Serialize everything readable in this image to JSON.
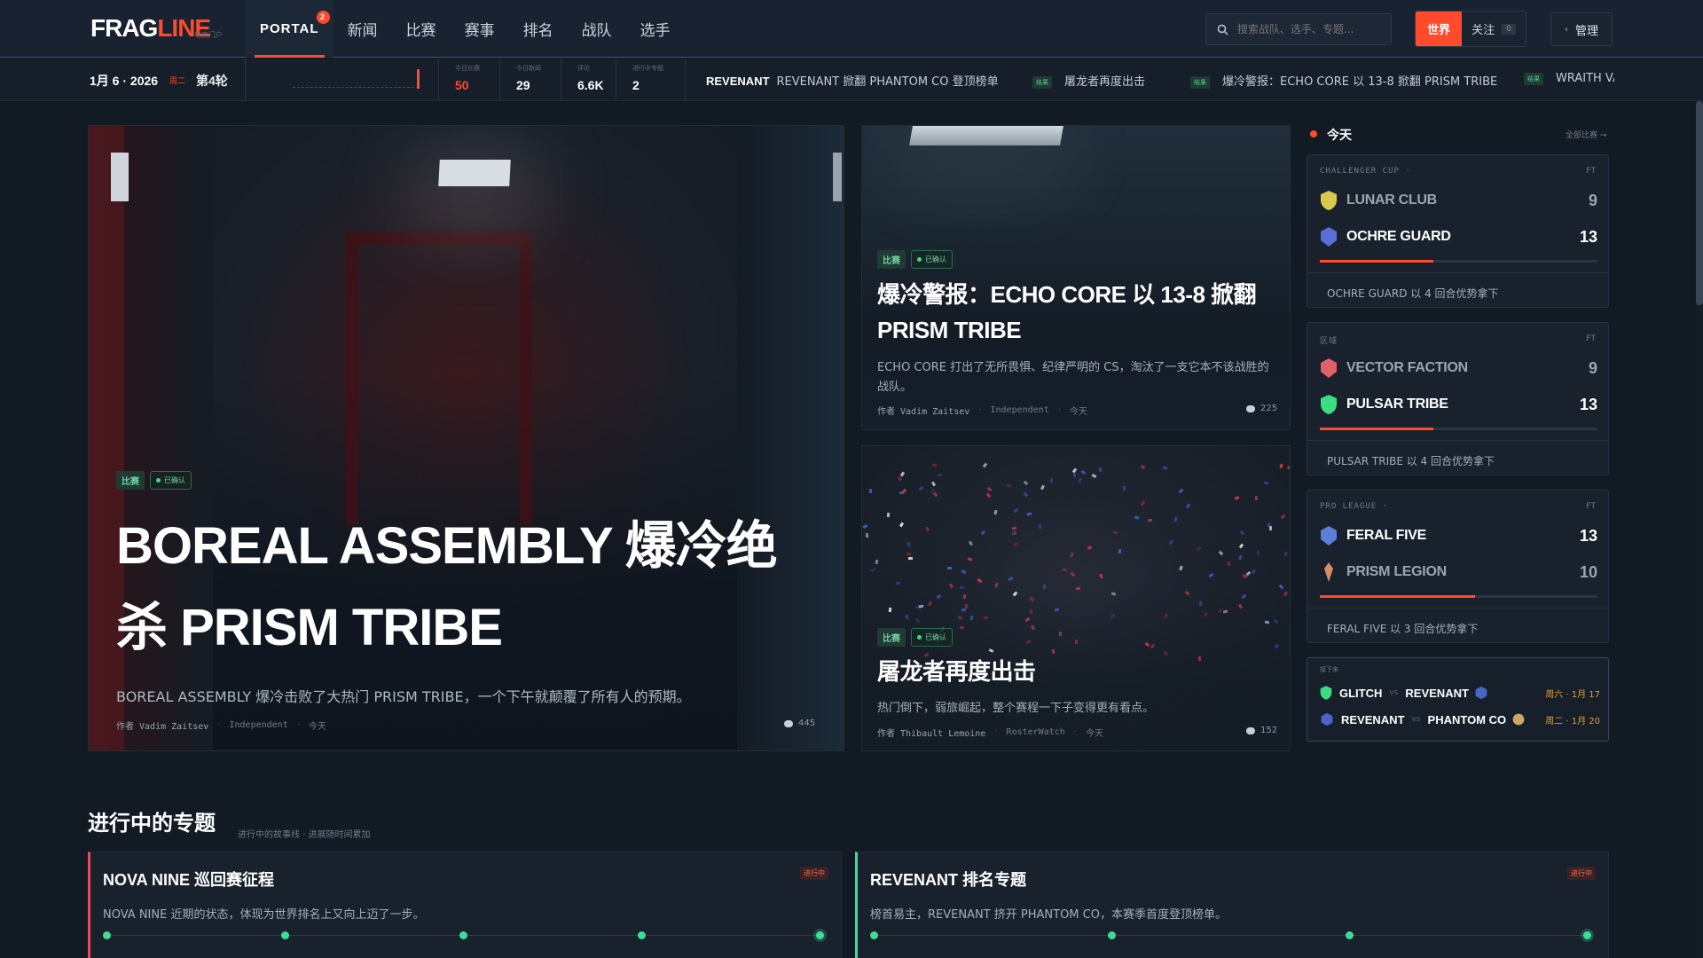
{
  "header": {
    "logo_part1": "FRAG",
    "logo_part2": "LINE",
    "logo_sub": "电竞门户",
    "nav": [
      {
        "label": "PORTAL",
        "badge": "2"
      },
      {
        "label": "新闻"
      },
      {
        "label": "比赛"
      },
      {
        "label": "赛事"
      },
      {
        "label": "排名"
      },
      {
        "label": "战队"
      },
      {
        "label": "选手"
      }
    ],
    "search_placeholder": "搜索战队、选手、专题...",
    "scope_world": "世界",
    "scope_follow": "关注",
    "follow_count": "0",
    "admin_label": "管理",
    "admin_icon": "chevron-left-icon",
    "accent_color": "#ff4a2b"
  },
  "ticker": {
    "date": "1月 6 · 2026",
    "weekday": "周二",
    "round": "第4轮",
    "stats": [
      {
        "label": "今日比赛",
        "value": "50"
      },
      {
        "label": "今日新闻",
        "value": "29"
      },
      {
        "label": "评论",
        "value": "6.6K"
      },
      {
        "label": "进行中专题",
        "value": "2"
      }
    ],
    "news": [
      {
        "tag": "",
        "team": "REVENANT",
        "text": "REVENANT 掀翻 PHANTOM CO 登顶榜单"
      },
      {
        "tag": "结果",
        "team": "",
        "text": "屠龙者再度出击"
      },
      {
        "tag": "结果",
        "team": "",
        "text": "爆冷警报：ECHO CORE 以 13-8 掀翻 PRISM TRIBE"
      },
      {
        "tag": "结果",
        "team": "",
        "text": "WRAITH VA"
      }
    ]
  },
  "hero": {
    "tag": "比赛",
    "confirmed": "已确认",
    "title": "BOREAL ASSEMBLY 爆冷绝杀 PRISM TRIBE",
    "description": "BOREAL ASSEMBLY 爆冷击败了大热门 PRISM TRIBE，一个下午就颠覆了所有人的预期。",
    "author": "作者 Vadim Zaitsev",
    "source": "Independent",
    "time": "今天",
    "comments": "445"
  },
  "mid_cards": [
    {
      "tag": "比赛",
      "confirmed": "已确认",
      "title": "爆冷警报：ECHO CORE 以 13-8 掀翻 PRISM TRIBE",
      "description": "ECHO CORE 打出了无所畏惧、纪律严明的 CS，淘汰了一支它本不该战胜的战队。",
      "author": "作者 Vadim Zaitsev",
      "source": "Independent",
      "time": "今天",
      "comments": "225"
    },
    {
      "tag": "比赛",
      "confirmed": "已确认",
      "title": "屠龙者再度出击",
      "description": "热门倒下，弱旅崛起，整个赛程一下子变得更有看点。",
      "author": "作者 Thibault Lemoine",
      "source": "RosterWatch",
      "time": "今天",
      "comments": "152"
    }
  ],
  "sidebar": {
    "today": "今天",
    "all_matches": "全部比赛 →",
    "matches": [
      {
        "league": "CHALLENGER CUP ·",
        "status": "FT",
        "team1": "LUNAR CLUB",
        "score1": "9",
        "logo1": "#d8c94a",
        "team2": "OCHRE GUARD",
        "score2": "13",
        "logo2": "#5a6fd6",
        "winner": 2,
        "progress": 0.41,
        "summary": "OCHRE GUARD 以 4 回合优势拿下"
      },
      {
        "league": "区域",
        "status": "FT",
        "team1": "VECTOR FACTION",
        "score1": "9",
        "logo1": "#e0606a",
        "team2": "PULSAR TRIBE",
        "score2": "13",
        "logo2": "#3ddc84",
        "winner": 2,
        "progress": 0.41,
        "summary": "PULSAR TRIBE 以 4 回合优势拿下"
      },
      {
        "league": "PRO LEAGUE ·",
        "status": "FT",
        "team1": "FERAL FIVE",
        "score1": "13",
        "logo1": "#5b7ed8",
        "team2": "PRISM LEGION",
        "score2": "10",
        "logo2": "#d88a6a",
        "winner": 1,
        "progress": 0.56,
        "summary": "FERAL FIVE 以 3 回合优势拿下"
      }
    ],
    "upcoming_label": "接下来",
    "upcoming": [
      {
        "team1": "GLITCH",
        "vs": "vs",
        "team2": "REVENANT",
        "date": "周六 · 1月 17",
        "logo1": "#3ddc84",
        "logo2": "#4a64c8"
      },
      {
        "team1": "REVENANT",
        "vs": "vs",
        "team2": "PHANTOM CO",
        "date": "周二 · 1月 20",
        "logo1": "#4a64c8",
        "logo2": "#c8a86a"
      }
    ]
  },
  "storylines": {
    "title": "进行中的专题",
    "subtitle": "进行中的故事线 · 进展随时间累加",
    "items": [
      {
        "title": "NOVA NINE 巡回赛征程",
        "badge": "进行中",
        "description": "NOVA NINE 近期的状态，体现为世界排名上又向上迈了一步。",
        "color": "#e84a5f",
        "steps": 5
      },
      {
        "title": "REVENANT 排名专题",
        "badge": "进行中",
        "description": "榜首易主，REVENANT 挤开 PHANTOM CO，本赛季首度登顶榜单。",
        "color": "#3ddc97",
        "steps": 4
      }
    ]
  }
}
